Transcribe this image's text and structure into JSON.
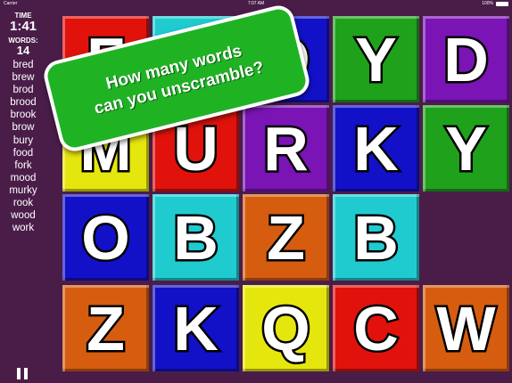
{
  "status": {
    "carrier": "Carrier",
    "time": "7:07 AM",
    "battery": "100%"
  },
  "sidebar": {
    "time_label": "TIME",
    "time_value": "1:41",
    "words_label": "WORDS:",
    "words_count": "14",
    "words": [
      "bred",
      "brew",
      "brod",
      "brood",
      "brook",
      "brow",
      "bury",
      "food",
      "fork",
      "mood",
      "murky",
      "rook",
      "wood",
      "work"
    ]
  },
  "banner": {
    "line1": "How many words",
    "line2": "can you unscramble?"
  },
  "colors": {
    "red": "#e1120c",
    "cyan": "#20cbd0",
    "blue": "#1211c8",
    "green": "#1fa11c",
    "purple": "#7a14b4",
    "yellow": "#e6e60f",
    "orange": "#d65d10",
    "background": "#4a1d49"
  },
  "tiles": [
    [
      {
        "letter": "F",
        "color": "red"
      },
      {
        "letter": "",
        "color": "cyan"
      },
      {
        "letter": "O",
        "color": "blue"
      },
      {
        "letter": "Y",
        "color": "green"
      },
      {
        "letter": "D",
        "color": "purple"
      }
    ],
    [
      {
        "letter": "M",
        "color": "yellow"
      },
      {
        "letter": "U",
        "color": "red"
      },
      {
        "letter": "R",
        "color": "purple"
      },
      {
        "letter": "K",
        "color": "blue"
      },
      {
        "letter": "Y",
        "color": "green"
      }
    ],
    [
      {
        "letter": "O",
        "color": "blue"
      },
      {
        "letter": "B",
        "color": "cyan"
      },
      {
        "letter": "Z",
        "color": "orange"
      },
      {
        "letter": "B",
        "color": "cyan"
      },
      null
    ],
    [
      {
        "letter": "Z",
        "color": "orange"
      },
      {
        "letter": "K",
        "color": "blue"
      },
      {
        "letter": "Q",
        "color": "yellow"
      },
      {
        "letter": "C",
        "color": "red"
      },
      {
        "letter": "W",
        "color": "orange"
      }
    ]
  ]
}
